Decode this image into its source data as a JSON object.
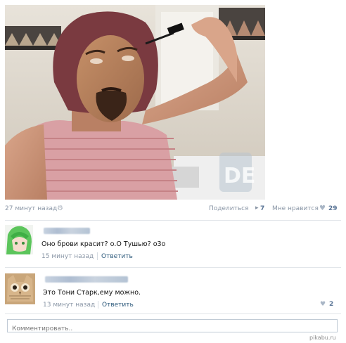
{
  "post": {
    "image_alt": "Edited photo of a man applying mascara in front of a bathroom mirror",
    "image_watermark": "DE",
    "time": "27 минут назад",
    "share_label": "Поделиться",
    "share_count": "7",
    "like_label": "Мне нравится",
    "like_count": "29"
  },
  "comments": [
    {
      "text": "Оно брови красит? о.О Тушью? о3о",
      "time": "15 минут назад",
      "reply": "Ответить"
    },
    {
      "text": "Это Тони Старк,ему можно.",
      "time": "13 минут назад",
      "reply": "Ответить",
      "likes": "2"
    }
  ],
  "composer": {
    "placeholder": "Комментировать.."
  },
  "watermark": "pikabu.ru",
  "colors": {
    "link": "#2b587a",
    "muted": "#8a96a6",
    "count": "#5a7596",
    "border": "#c0cad5"
  }
}
